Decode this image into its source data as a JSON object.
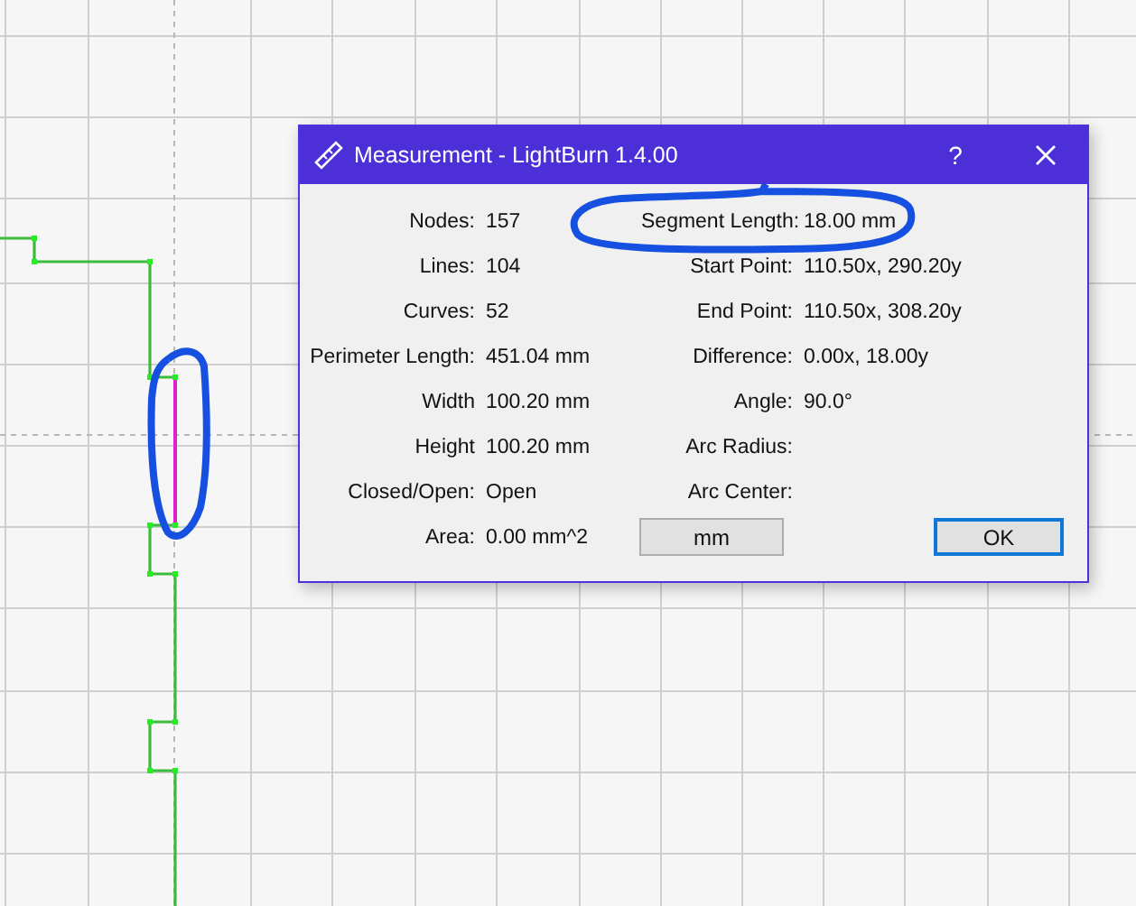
{
  "dialog": {
    "title": "Measurement - LightBurn 1.4.00",
    "help": "?",
    "rows": [
      {
        "left": {
          "label": "Nodes:",
          "value": "157"
        },
        "right": {
          "label": "Segment Length:",
          "value": "18.00 mm"
        }
      },
      {
        "left": {
          "label": "Lines:",
          "value": "104"
        },
        "right": {
          "label": "Start Point:",
          "value": "110.50x, 290.20y"
        }
      },
      {
        "left": {
          "label": "Curves:",
          "value": "52"
        },
        "right": {
          "label": "End Point:",
          "value": "110.50x, 308.20y"
        }
      },
      {
        "left": {
          "label": "Perimeter Length:",
          "value": "451.04 mm"
        },
        "right": {
          "label": "Difference:",
          "value": "0.00x, 18.00y"
        }
      },
      {
        "left": {
          "label": "Width",
          "value": "100.20 mm"
        },
        "right": {
          "label": "Angle:",
          "value": "90.0°"
        }
      },
      {
        "left": {
          "label": "Height",
          "value": "100.20 mm"
        },
        "right": {
          "label": "Arc Radius:"
        }
      },
      {
        "left": {
          "label": "Closed/Open:",
          "value": "Open"
        },
        "right": {
          "label": "Arc Center:"
        }
      },
      {
        "left": {
          "label": "Area:",
          "value": "0.00 mm^2"
        }
      }
    ],
    "buttons": [
      {
        "label": "mm",
        "focused": false
      },
      {
        "label": "OK",
        "focused": true
      }
    ]
  }
}
